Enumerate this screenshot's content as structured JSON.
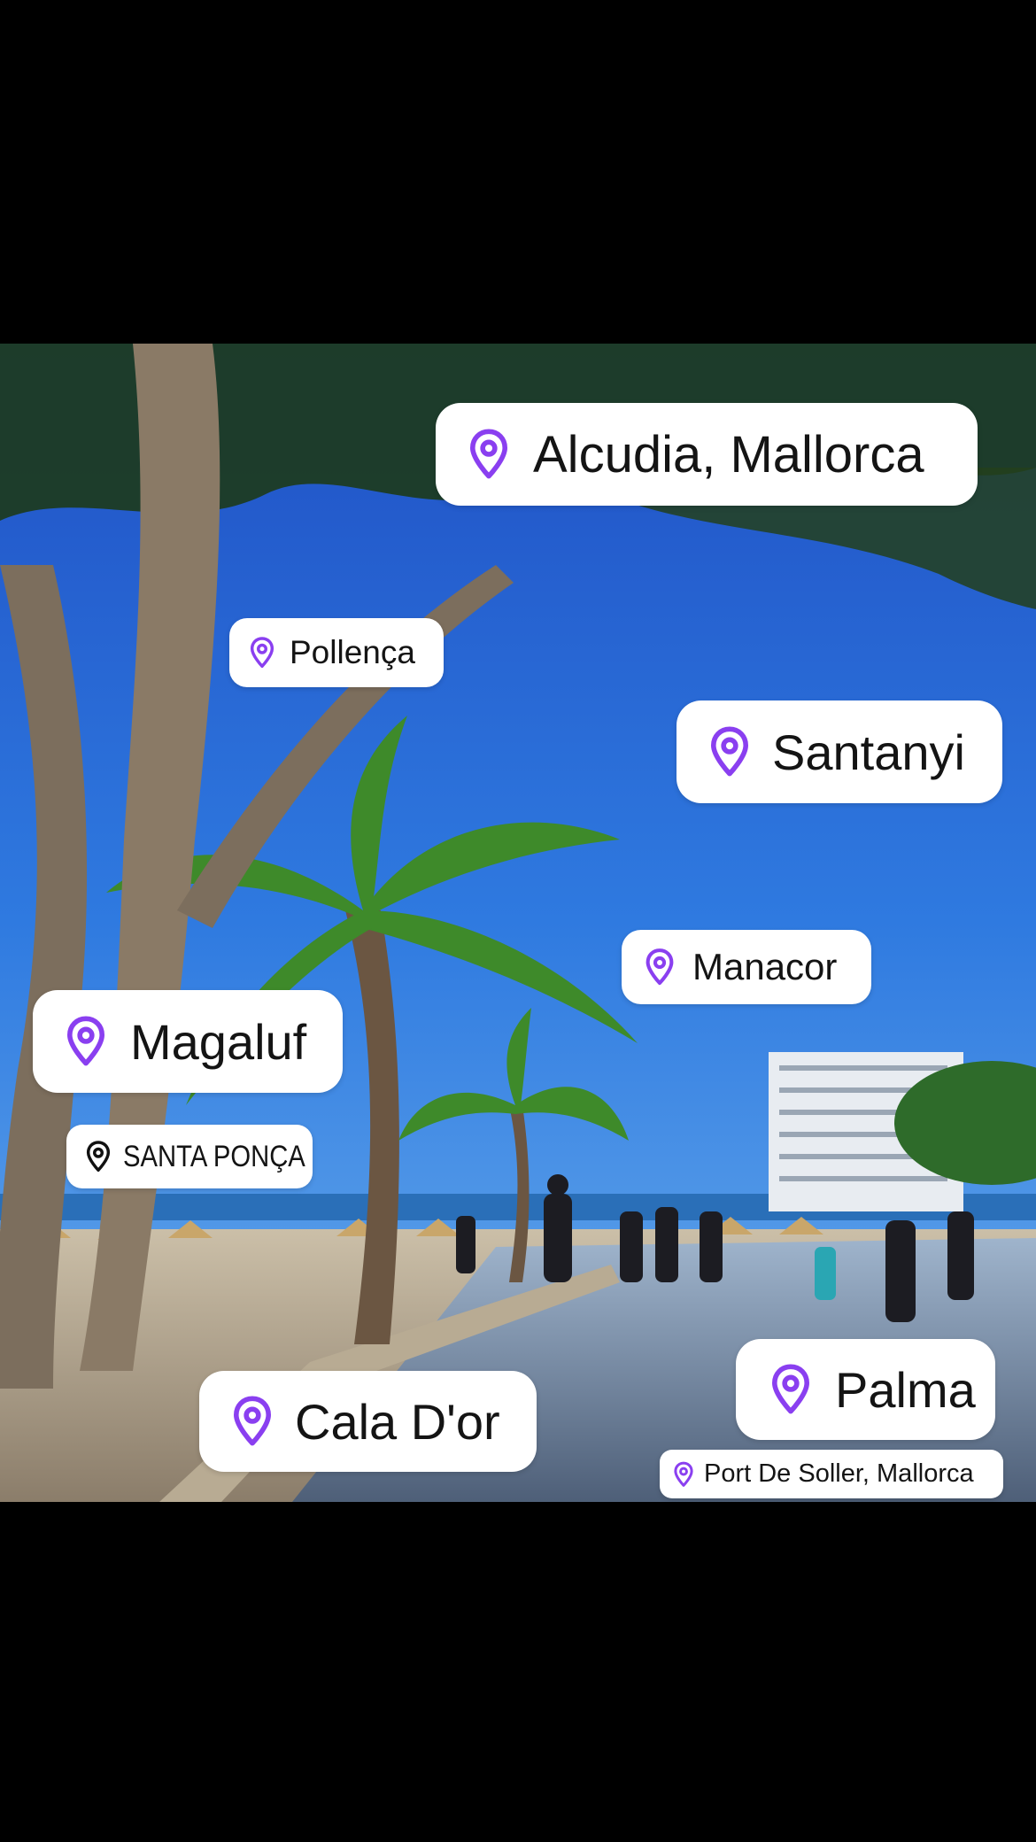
{
  "tags": {
    "alcudia": {
      "label": "Alcudia, Mallorca",
      "icon": "map-pin-icon"
    },
    "pollenca": {
      "label": "Pollença",
      "icon": "map-pin-icon"
    },
    "santanyi": {
      "label": "Santanyi",
      "icon": "map-pin-icon"
    },
    "manacor": {
      "label": "Manacor",
      "icon": "map-pin-icon"
    },
    "magaluf": {
      "label": "Magaluf",
      "icon": "map-pin-icon"
    },
    "santa_ponca": {
      "label": "SANTA PONÇA",
      "icon": "map-pin-outline-icon"
    },
    "palma": {
      "label": "Palma",
      "icon": "map-pin-icon"
    },
    "cala_dor": {
      "label": "Cala D'or",
      "icon": "map-pin-icon"
    },
    "port_de_soller": {
      "label": "Port De Soller, Mallorca",
      "icon": "map-pin-icon"
    }
  },
  "colors": {
    "pin": "#8a3ff0",
    "pin_plain": "#111111",
    "tag_bg": "#ffffff",
    "backdrop": "#000000"
  }
}
